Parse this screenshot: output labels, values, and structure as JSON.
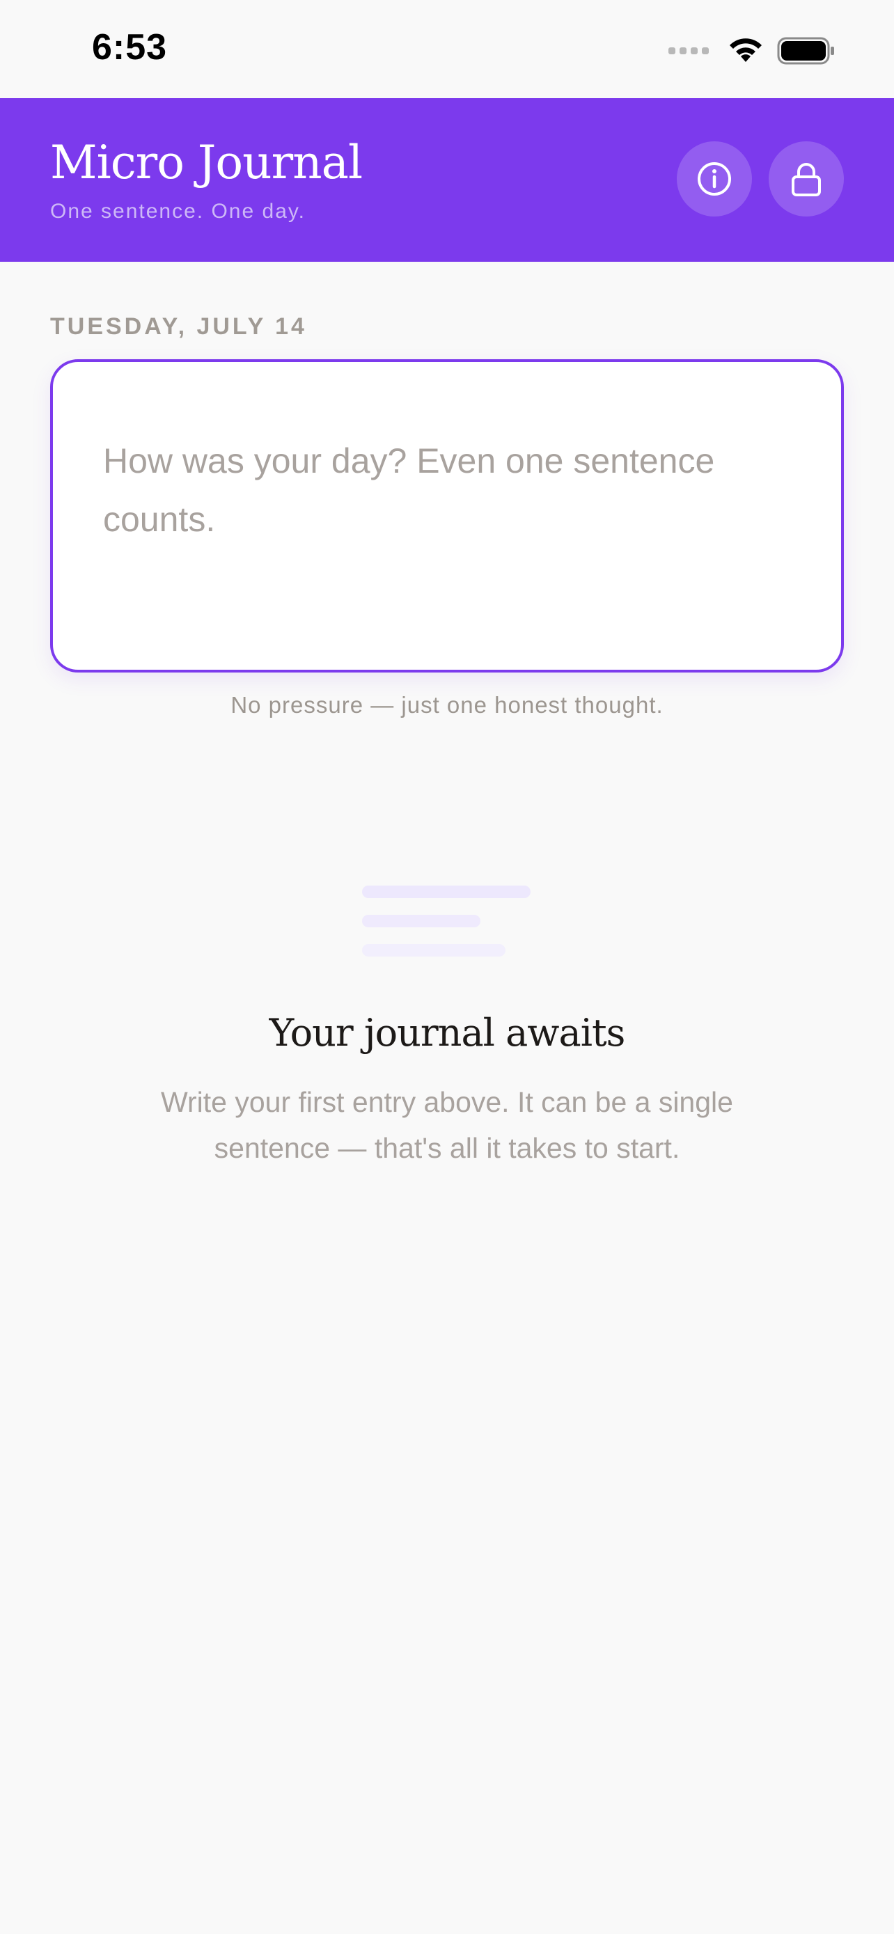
{
  "status_bar": {
    "time": "6:53"
  },
  "header": {
    "title": "Micro Journal",
    "subtitle": "One sentence. One day.",
    "background": "#7c3aed",
    "info_icon": "info-circle-icon",
    "lock_icon": "lock-icon"
  },
  "main": {
    "date_label": "TUESDAY, JULY 14",
    "entry": {
      "value": "",
      "placeholder": "How was your day? Even one sentence counts."
    },
    "hint": "No pressure — just one honest thought."
  },
  "empty_state": {
    "icon": "text-lines-icon",
    "title": "Your journal awaits",
    "body": "Write your first entry above. It can be a single sentence — that's all it takes to start."
  }
}
